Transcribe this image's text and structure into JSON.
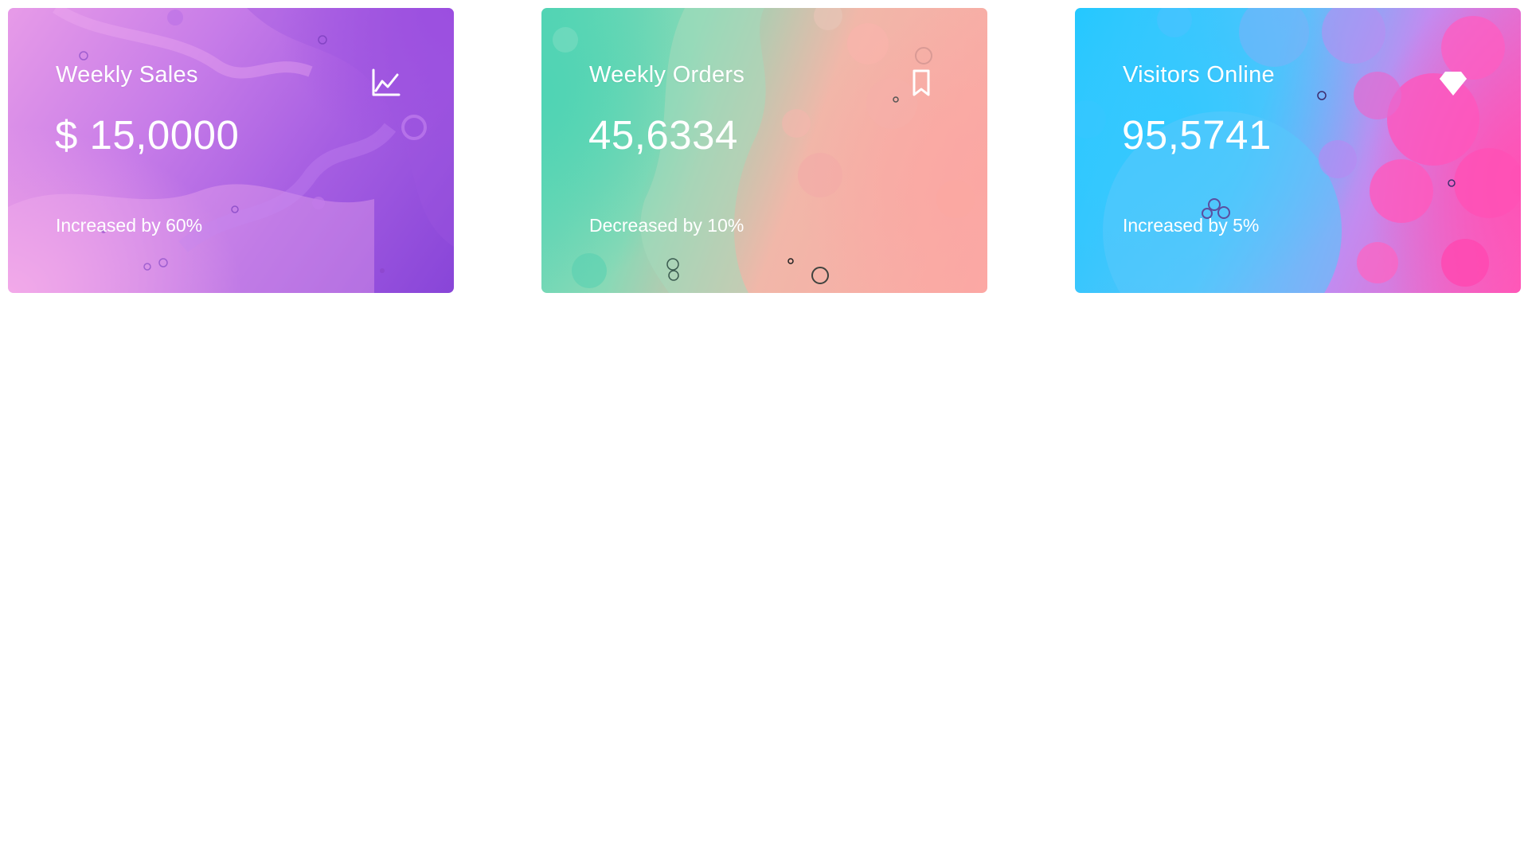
{
  "cards": [
    {
      "title": "Weekly Sales",
      "value": "$ 15,0000",
      "change": "Increased by 60%",
      "icon": "chart-line-icon"
    },
    {
      "title": "Weekly Orders",
      "value": "45,6334",
      "change": "Decreased by 10%",
      "icon": "bookmark-icon"
    },
    {
      "title": "Visitors Online",
      "value": "95,5741",
      "change": "Increased by 5%",
      "icon": "diamond-icon"
    }
  ],
  "colors": {
    "card_1": [
      "#e79be8",
      "#8845d8"
    ],
    "card_2": [
      "#56d5b5",
      "#fca8a4"
    ],
    "card_3": [
      "#1ec8ff",
      "#ff5cba"
    ],
    "text": "#ffffff"
  }
}
